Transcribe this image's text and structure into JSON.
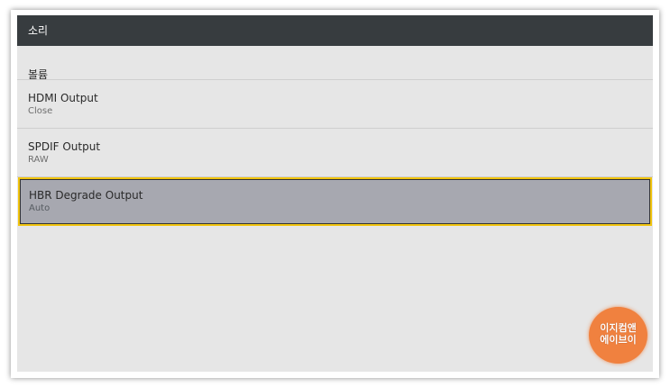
{
  "header": {
    "title": "소리"
  },
  "settings": {
    "volume": {
      "label": "볼륨"
    },
    "items": [
      {
        "label": "HDMI Output",
        "value": "Close"
      },
      {
        "label": "SPDIF Output",
        "value": "RAW"
      },
      {
        "label": "HBR Degrade Output",
        "value": "Auto"
      }
    ]
  },
  "watermark": {
    "line1": "이지컴앤",
    "line2": "에이브이"
  },
  "colors": {
    "titlebar": "#373c3f",
    "background": "#e6e6e6",
    "selected": "#a7a8b0",
    "focus_border": "#f1c40f",
    "badge": "#f0813f"
  }
}
